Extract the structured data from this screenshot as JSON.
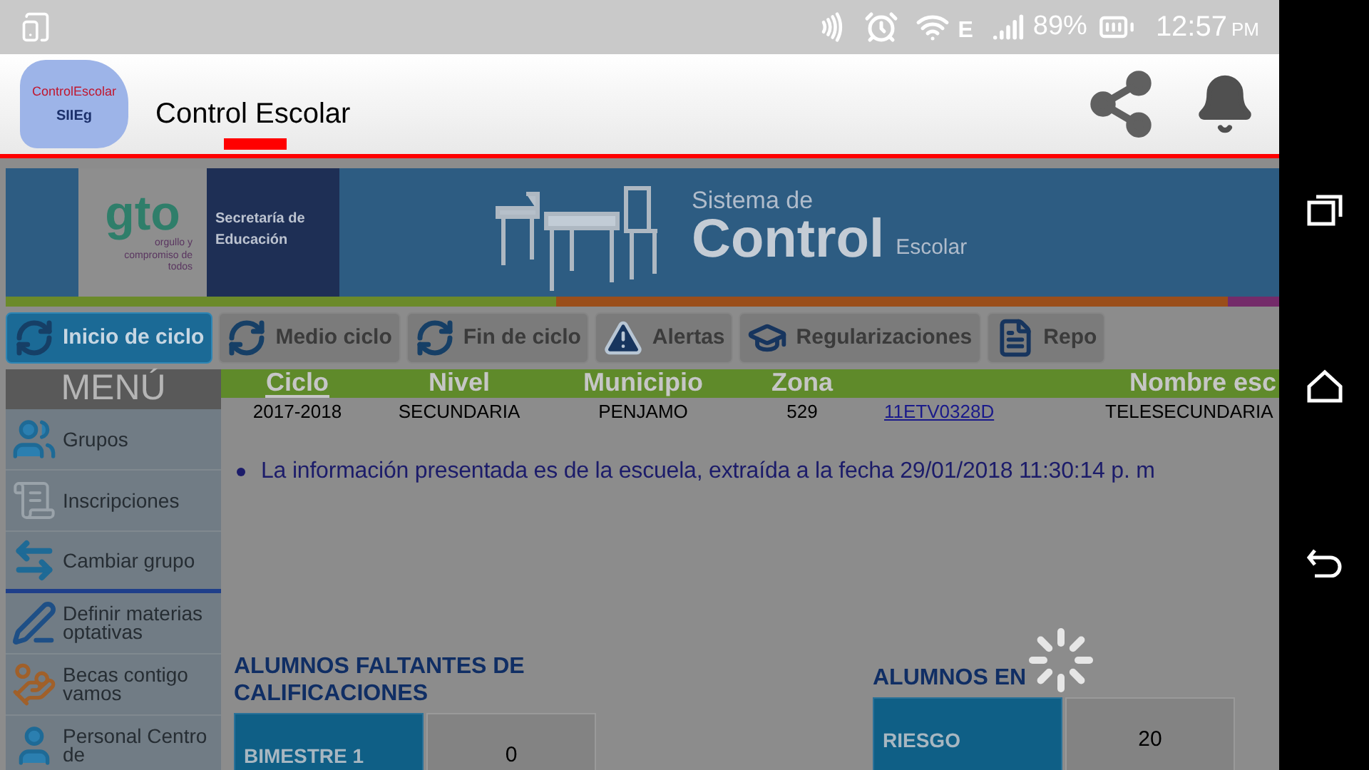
{
  "status_bar": {
    "network": "E",
    "battery": "89%",
    "time": "12:57",
    "period": "PM"
  },
  "app_bar": {
    "logo_lines": [
      "ControlEscolar",
      "SIIEg"
    ],
    "title": "Control Escolar"
  },
  "banner": {
    "logo": "gto",
    "tagline": "orgullo y compromiso de todos",
    "department": "Secretaría de Educación",
    "system_small": "Sistema de",
    "system_large": "Control",
    "system_suffix": "Escolar"
  },
  "tabs": [
    {
      "label": "Inicio de ciclo",
      "kind": "cycle",
      "selected": true
    },
    {
      "label": "Medio ciclo",
      "kind": "cycle",
      "selected": false
    },
    {
      "label": "Fin de ciclo",
      "kind": "cycle",
      "selected": false
    },
    {
      "label": "Alertas",
      "kind": "alert",
      "selected": false
    },
    {
      "label": "Regularizaciones",
      "kind": "cap",
      "selected": false
    },
    {
      "label": "Repo",
      "kind": "report",
      "selected": false
    }
  ],
  "menu": {
    "title": "MENÚ",
    "items": [
      {
        "label": "Grupos",
        "kind": "people",
        "selected": false
      },
      {
        "label": "Inscripciones",
        "kind": "paper",
        "selected": false
      },
      {
        "label": "Cambiar grupo",
        "kind": "swap",
        "selected": true
      },
      {
        "label": "Definir materias optativas",
        "kind": "pen",
        "selected": false
      },
      {
        "label": "Becas contigo vamos",
        "kind": "hands",
        "selected": false
      },
      {
        "label": "Personal Centro de",
        "kind": "person",
        "selected": false
      }
    ]
  },
  "table": {
    "columns": [
      {
        "label": "Ciclo",
        "link": true
      },
      {
        "label": "Nivel",
        "link": false
      },
      {
        "label": "Municipio",
        "link": false
      },
      {
        "label": "Zona",
        "link": false
      },
      {},
      {
        "label": "Nombre esc",
        "link": false
      }
    ],
    "rows": [
      {
        "cells": [
          {
            "text": "2017-2018",
            "link": false
          },
          {
            "text": "SECUNDARIA",
            "link": false
          },
          {
            "text": "PENJAMO",
            "link": false
          },
          {
            "text": "529",
            "link": false
          },
          {
            "text": "11ETV0328D",
            "link": true
          },
          {
            "text": "TELESECUNDARIA",
            "link": false
          }
        ]
      }
    ]
  },
  "notice": "La información presentada es de la escuela, extraída a la fecha 29/01/2018 11:30:14 p. m",
  "sections": [
    {
      "title": "ALUMNOS FALTANTES DE CALIFICACIONES",
      "label": "BIMESTRE 1",
      "value": "0"
    },
    {
      "title": "ALUMNOS EN",
      "label": "RIESGO",
      "value": "20"
    }
  ]
}
